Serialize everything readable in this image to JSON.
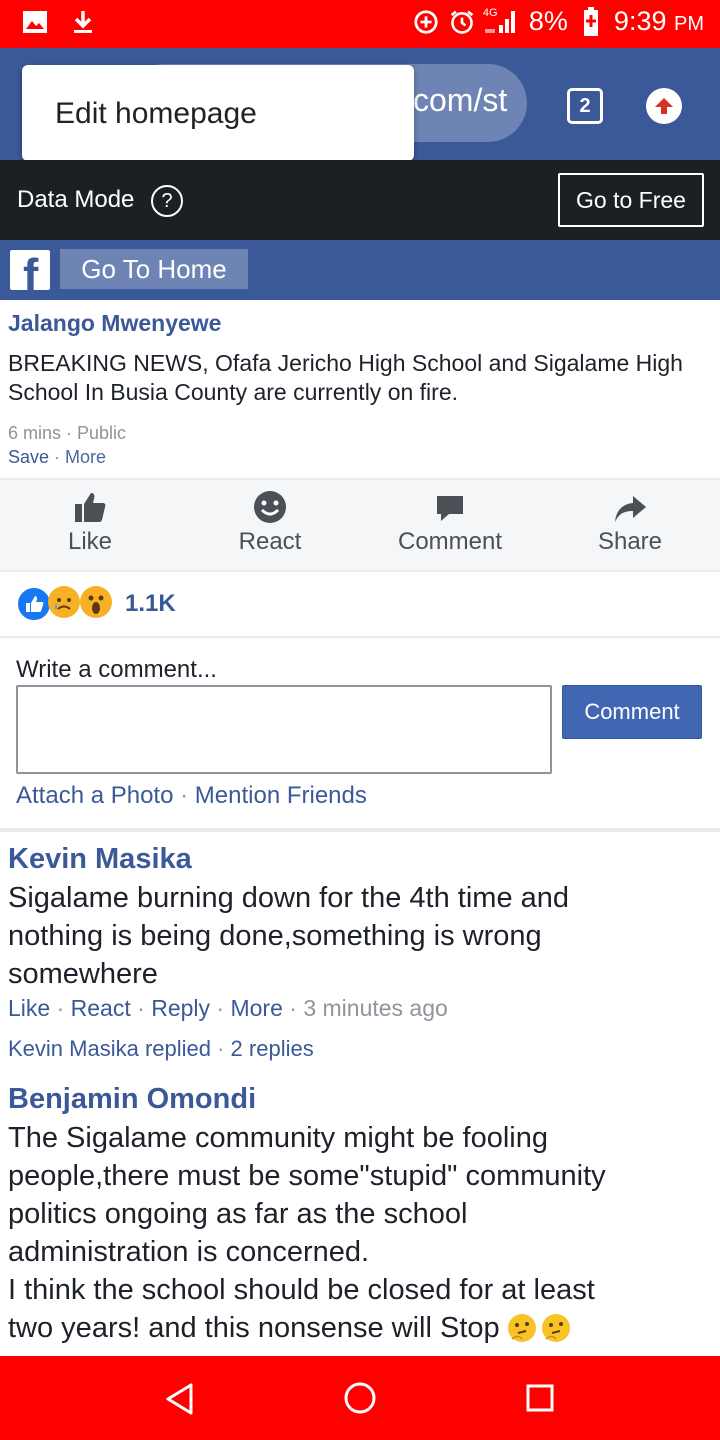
{
  "status_bar": {
    "battery": "8%",
    "time": "9:39",
    "time_suffix": "PM",
    "network": "4G",
    "colors": {
      "background": "#ff0000"
    }
  },
  "browser": {
    "url_fragment": "com/st",
    "tab_count": "2",
    "popup_item": "Edit homepage"
  },
  "data_bar": {
    "mode_label": "Data Mode",
    "help_symbol": "?",
    "go_free_label": "Go to Free"
  },
  "fb_bar": {
    "logo_letter": "f",
    "go_home_label": "Go To Home"
  },
  "post": {
    "author": "Jalango Mwenyewe",
    "text": "BREAKING NEWS, Ofafa Jericho High School and Sigalame High School In Busia County are currently on fire.",
    "time": "6 mins",
    "privacy": "Public",
    "save": "Save",
    "more": "More",
    "actions": {
      "like": "Like",
      "react": "React",
      "comment": "Comment",
      "share": "Share"
    },
    "reaction_count": "1.1K"
  },
  "composer": {
    "label": "Write a comment...",
    "input_value": "",
    "button": "Comment",
    "attach_photo": "Attach a Photo",
    "mention_friends": "Mention Friends"
  },
  "comments": [
    {
      "author": "Kevin Masika",
      "lines": [
        "Sigalame burning down for the 4th time and",
        "nothing is being done,something is wrong",
        "somewhere"
      ],
      "actions": {
        "like": "Like",
        "react": "React",
        "reply": "Reply",
        "more": "More"
      },
      "time": "3 minutes ago",
      "replies_author": "Kevin Masika replied",
      "replies_count": "2 replies"
    },
    {
      "author": "Benjamin Omondi",
      "lines": [
        "The Sigalame community might be fooling",
        "people,there must be some\"stupid\" community",
        "politics ongoing as far as the school",
        "administration is concerned.",
        "I think the school should be closed for at least",
        "two years! and this nonsense will Stop"
      ]
    }
  ],
  "colors": {
    "facebook_blue": "#3b5998",
    "link_blue": "#3b5998",
    "nav_red": "#ff0000",
    "data_bar": "#1d2023"
  }
}
